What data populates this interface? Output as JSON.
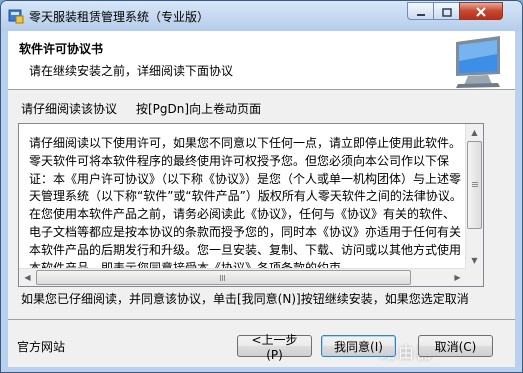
{
  "window": {
    "title": "零天服装租赁管理系统（专业版）"
  },
  "header": {
    "title": "软件许可协议书",
    "subtitle": "请在继续安装之前，详细阅读下面协议"
  },
  "instructions": {
    "read_label": "请仔细阅读该协议",
    "pgdn_hint": "按[PgDn]向上卷动页面"
  },
  "license": {
    "text": "请仔细阅读以下使用许可，如果您不同意以下任何一点，请立即停止使用此软件。零天软件可将本软件程序的最终使用许可权授予您。但您必须向本公司作以下保证：本《用户许可协议》（以下称《协议》）是您（个人或单一机构团体）与上述零天管理系统（以下称“软件”或“软件产品”）版权所有人零天软件之间的法律协议。在您使用本软件产品之前，请务必阅读此《协议》，任何与《协议》有关的软件、电子文档等都应是按本协议的条款而授予您的，同时本《协议》亦适用于任何有关本软件产品的后期发行和升级。您一旦安装、复制、下载、访问或以其他方式使用本软件产品，即表示您同意接受本《协议》各项条款的约束。"
  },
  "footer": {
    "hint": "如果您已仔细阅读，并同意该协议，单击[我同意(N)]按钮继续安装，如果您选定取消",
    "website": "官方网站",
    "back_label": "<上一步(P)",
    "agree_label": "我同意(I)",
    "cancel_label": "取消(C)"
  },
  "watermark": "路由器",
  "icons": {
    "app": "installer-icon",
    "minimize": "minimize-icon",
    "maximize": "maximize-icon",
    "close": "close-icon",
    "monitor": "monitor-icon"
  },
  "colors": {
    "title_bar": "#b5cdea",
    "close_button": "#c7472f",
    "default_button_border": "#3c7fb1"
  }
}
